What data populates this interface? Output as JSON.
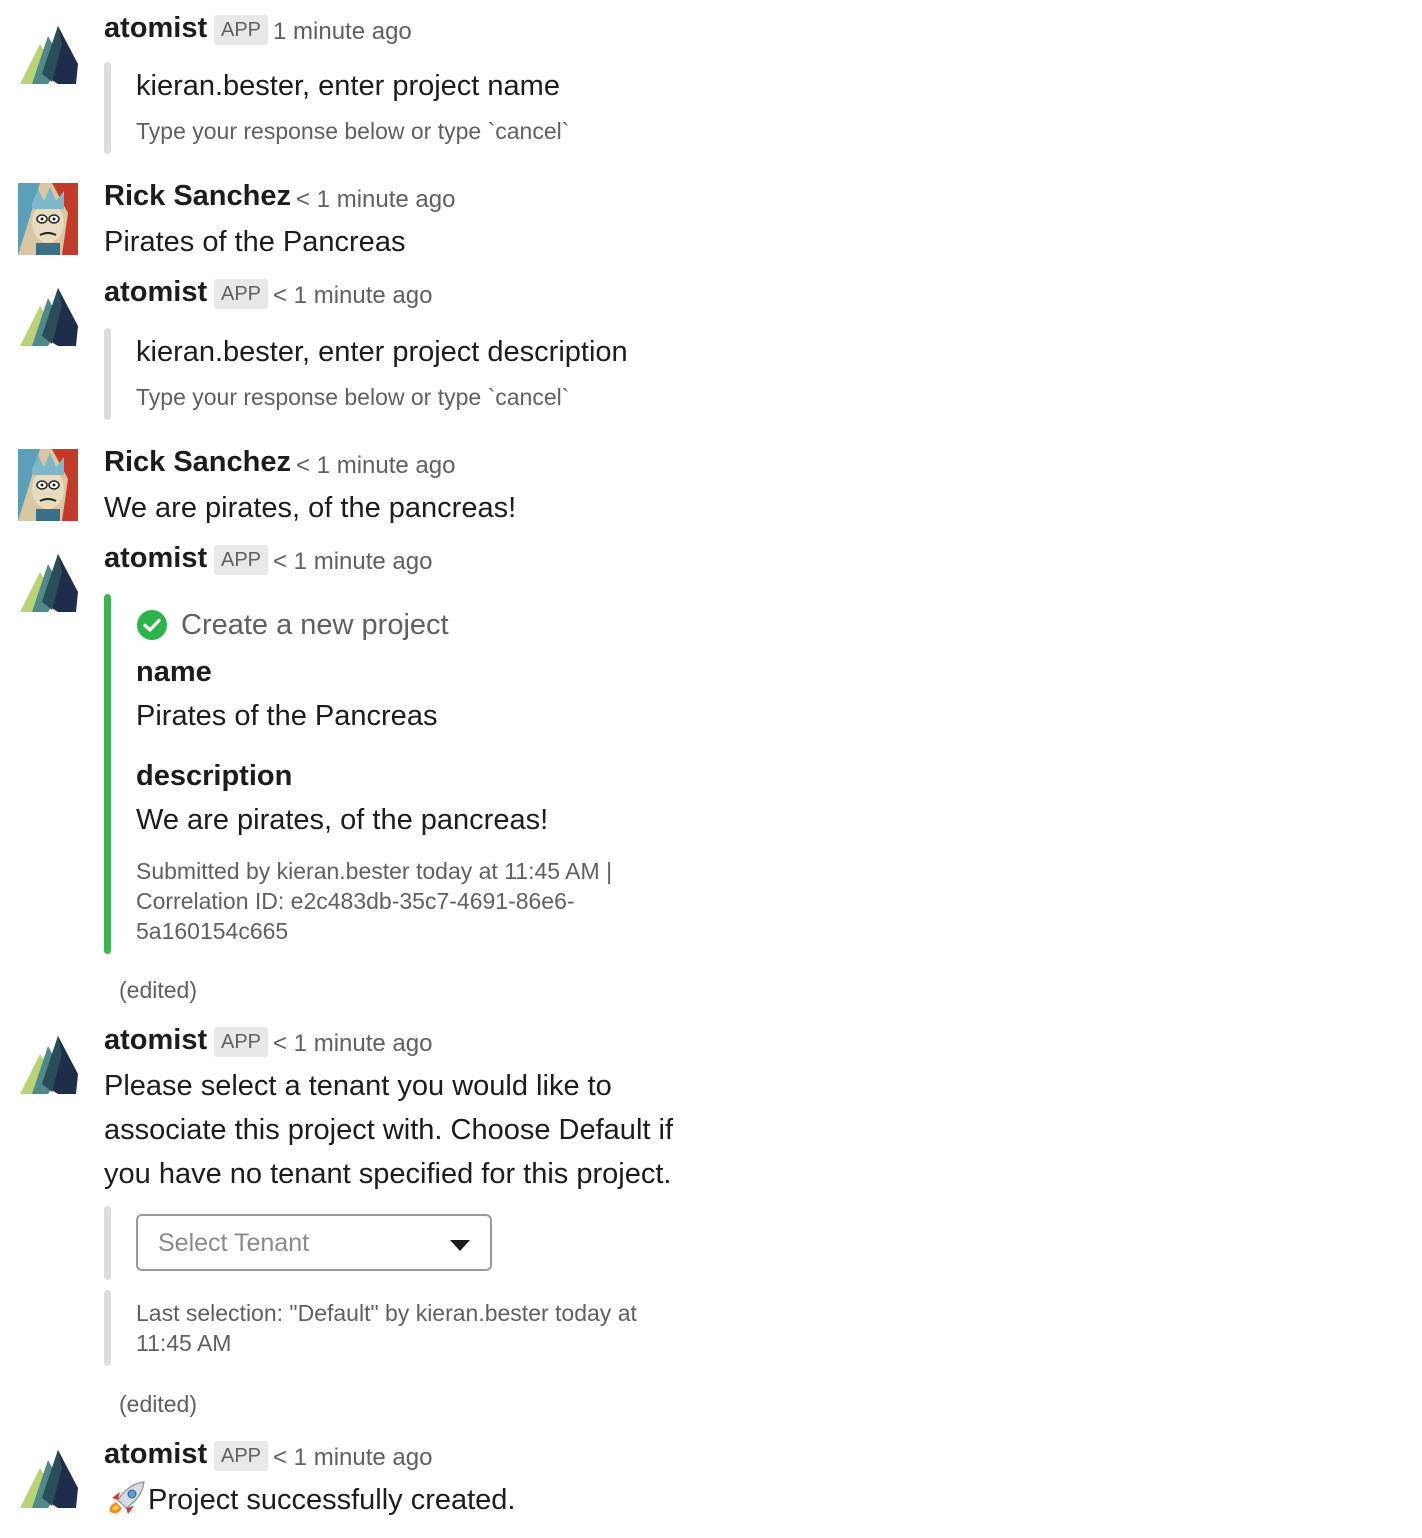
{
  "messages": [
    {
      "author": "atomist",
      "badge": "APP",
      "time": "1 minute ago",
      "title": "kieran.bester, enter project name",
      "hint": "Type your response below or type `cancel`"
    },
    {
      "author": "Rick Sanchez",
      "time": "< 1 minute ago",
      "text": "Pirates of the Pancreas"
    },
    {
      "author": "atomist",
      "badge": "APP",
      "time": "< 1 minute ago",
      "title": "kieran.bester, enter project description",
      "hint": "Type your response below or type `cancel`"
    },
    {
      "author": "Rick Sanchez",
      "time": "< 1 minute ago",
      "text": "We are pirates, of the pancreas!"
    },
    {
      "author": "atomist",
      "badge": "APP",
      "time": "< 1 minute ago",
      "card": {
        "title": "Create a new project",
        "field1_label": "name",
        "field1_value": "Pirates of the Pancreas",
        "field2_label": "description",
        "field2_value": "We are pirates, of the pancreas!",
        "footer_line1": "Submitted by kieran.bester today at 11:45 AM |",
        "footer_line2": "Correlation ID: e2c483db-35c7-4691-86e6-",
        "footer_line3": "5a160154c665"
      },
      "edited": "(edited)"
    },
    {
      "author": "atomist",
      "badge": "APP",
      "time": "< 1 minute ago",
      "text_line1": "Please select a tenant you would like to",
      "text_line2": "associate this project with. Choose Default if",
      "text_line3": "you have no tenant specified for this project.",
      "select_placeholder": "Select Tenant",
      "last_selection_line1": "Last selection: \"Default\" by kieran.bester today at",
      "last_selection_line2": "11:45 AM",
      "edited": "(edited)"
    },
    {
      "author": "atomist",
      "badge": "APP",
      "time": "< 1 minute ago",
      "text": "Project successfully created."
    }
  ],
  "colors": {
    "success_bar": "#3fb34f",
    "neutral_bar": "#dddddd",
    "check": "#2eb34a"
  },
  "icons": [
    "atomist-logo-icon",
    "rick-avatar",
    "check-circle-icon",
    "dropdown-caret-icon",
    "rocket-icon"
  ]
}
